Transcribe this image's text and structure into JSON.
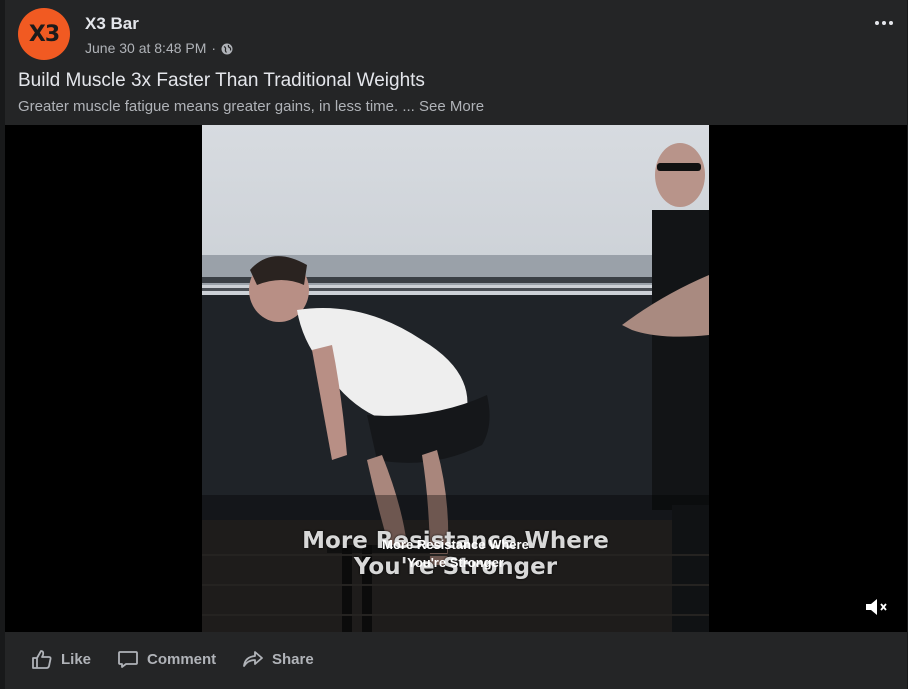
{
  "header": {
    "avatar_text": "X3",
    "page_name": "X3 Bar",
    "timestamp": "June 30 at 8:48 PM",
    "separator": "·",
    "privacy_icon": "globe-icon",
    "more_icon": "more-dots-icon"
  },
  "post": {
    "headline": "Build Muscle 3x Faster Than Traditional Weights",
    "description": "Greater muscle fatigue means greater gains, in less time. ...",
    "see_more": "See More"
  },
  "video": {
    "caption_large_line1": "More Resistance Where",
    "caption_large_line2": "You're Stronger",
    "caption_small_line1": "More Resistance Where",
    "caption_small_line2": "You're Stronger",
    "mute_icon": "volume-muted-icon"
  },
  "actions": {
    "like": "Like",
    "comment": "Comment",
    "share": "Share"
  },
  "colors": {
    "background": "#18191a",
    "card": "#242526",
    "brand_orange": "#f15a22",
    "secondary_text": "#b0b3b8"
  }
}
